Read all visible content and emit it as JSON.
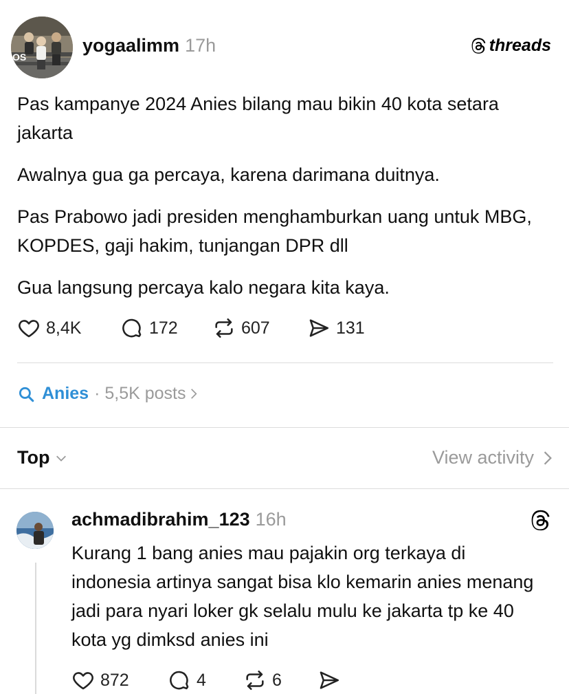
{
  "post": {
    "username": "yogaalimm",
    "time": "17h",
    "brand": "threads",
    "paragraphs": [
      "Pas kampanye 2024 Anies bilang mau bikin 40 kota setara jakarta",
      "Awalnya gua ga percaya, karena darimana duitnya.",
      "Pas Prabowo jadi presiden menghamburkan uang untuk MBG, KOPDES, gaji hakim, tunjangan DPR dll",
      "Gua langsung percaya kalo negara kita kaya."
    ],
    "likes": "8,4K",
    "comments": "172",
    "reposts": "607",
    "shares": "131",
    "avatar_overlay_text": "OS"
  },
  "topic": {
    "name": "Anies",
    "meta": "· 5,5K posts"
  },
  "sort": {
    "label": "Top",
    "view_activity": "View activity"
  },
  "reply": {
    "username": "achmadibrahim_123",
    "time": "16h",
    "text": "Kurang 1 bang anies mau pajakin org terkaya di indonesia artinya sangat bisa klo kemarin anies menang jadi para nyari loker gk selalu mulu ke jakarta tp ke 40 kota yg dimksd anies ini",
    "likes": "872",
    "comments": "4",
    "reposts": "6"
  },
  "colors": {
    "accent_link": "#2f8fd6",
    "muted_text": "#9a9a9a",
    "divider": "#dcdcdc"
  },
  "icons": [
    "heart-icon",
    "comment-icon",
    "repost-icon",
    "share-icon",
    "search-icon",
    "chevron-down-icon",
    "chevron-right-icon",
    "threads-logo-icon"
  ]
}
